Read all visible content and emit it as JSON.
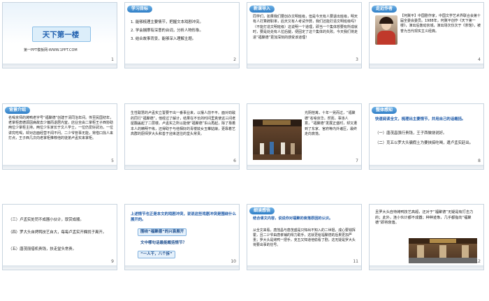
{
  "slides": [
    {
      "num": "1",
      "title": "天下第一楼",
      "footer": "第一PPT模板网-WWW.1PPT.COM"
    },
    {
      "num": "2",
      "header": "学习目标",
      "items": [
        "1. 能够梳理主要情节，把握文本戏剧冲突。",
        "2. 学会揣摩有深意的台词，分析人物形象。",
        "3. 结合故事背景，能够深入理解主题。"
      ]
    },
    {
      "num": "3",
      "header": "新课导入",
      "text": "同学们，如果我们要创办文明班级，但是今天有人要退出班级，明天有人打算辞职率，后天又有人考试作弊，我们还能打造文明班级吗？（不能打造文明班级）这说明一个道理，即当一个集体想要有所成就时，要是处处有人拉后腿，便固定了这个集体的失败。今天我们将走进“福聚德”更加深刻的感受该道理！"
    },
    {
      "num": "4",
      "header": "走近作者",
      "text": "【何冀平】中国剧作家，中国文学艺术界联合会第十届全委会委员。1988年，何冀平创作《天下第一楼》，演出后轰动京城，演出场次仅次于《茶馆》，被誉为当代现实主义经典。"
    },
    {
      "num": "5",
      "header": "背景介绍",
      "text": "名噪京师的烤鸭老字号“福聚德”创建于清同治年间。传至民国初年，老掌柜唐德源因病故去少偏而退居内室，店业全由二掌柜王子西协助两位少掌柜主持。两位少东家长于文人学士，一位仍爱好武功，一位讲究吃喝，却对店面经营不闻不问。二少爷管事无能，常借口找人来打点，王子西几次向老掌柜推荐他的徒弟卢孟实来掌柜。"
    },
    {
      "num": "6",
      "text": "生性聪慧的卢孟实立誓要干出一番事业来，以摆人前不平。面对劲敌的同行“福聚德”，他经过了解计，结果在不长的时间里真使这三间老屋翻盖起了二层楼。卢孟实之所以能使“福聚德”东山再起，除了靠着本人的精明干练，还得助于与他相好的青楼妓女玉雏姑娘，更靠着艺高群的厨师罗大头和善于迎来送往的堂头常贵。"
    },
    {
      "num": "7",
      "text": "光阴荏苒，十年一晃而过，“福聚德”名噪京华。然而，事违人意，“福聚德”发展正盛时，却又遭到了东家、官府等内外诸压，最终走向衰落。"
    },
    {
      "num": "8",
      "header": "整体感知",
      "intro": "快速阅读全文，梳理出主要情节，并用自己的话概括。",
      "items": [
        "（一）唐茂昌强行贵钱，王子西做烧说好。",
        "（二）克五以罗大头骗假土为要挟搞吃喝，遭卢孟实赶出。"
      ]
    },
    {
      "num": "9",
      "items": [
        "（三）卢孟实处罚不成器小伙计，厚赏成顺。",
        "（四）罗大头自烤鸭技艺自大，每每卢孟实开欄找子离开。",
        "（五）唐茂丽借机贵钱，扶走堂头常贵。"
      ]
    },
    {
      "num": "10",
      "intro": "上述情节也正是本文的戏剧冲突，说说这些戏剧冲突是围绕什么展开的。",
      "box1": "围绕“福聚德”的兴衰展开",
      "box2": "文中哪句话最能概括情节？",
      "box3": "“一人干，八个拆”"
    },
    {
      "num": "11",
      "header": "细读感悟",
      "intro": "结合课文内容，说说你对福聚的衰落原因的认识。",
      "text": "从全文来看，唐茂昌与唐茂盛是只知出不知入的二世祖，成心要钱挥霍，且二少爷由唐孝铺的得力助手，这就更给福聚德的后果更加严重；罗大头是烤鸭一把手，克五又知道他偷看了剧，这无疑是罗大头将要出事的信号。"
    },
    {
      "num": "12",
      "text": "且罗大头自恃烤鸭技艺高超，还对于“福聚德”无疑是有打击力的；此外，连小伙计都不成器；种种迹象，几乎都指向“福聚德”即将衰落。"
    }
  ],
  "colors": {
    "accent": "#1e5aa8",
    "header_bg": "#2f7ec6",
    "title_blue": "#1f5fae"
  }
}
